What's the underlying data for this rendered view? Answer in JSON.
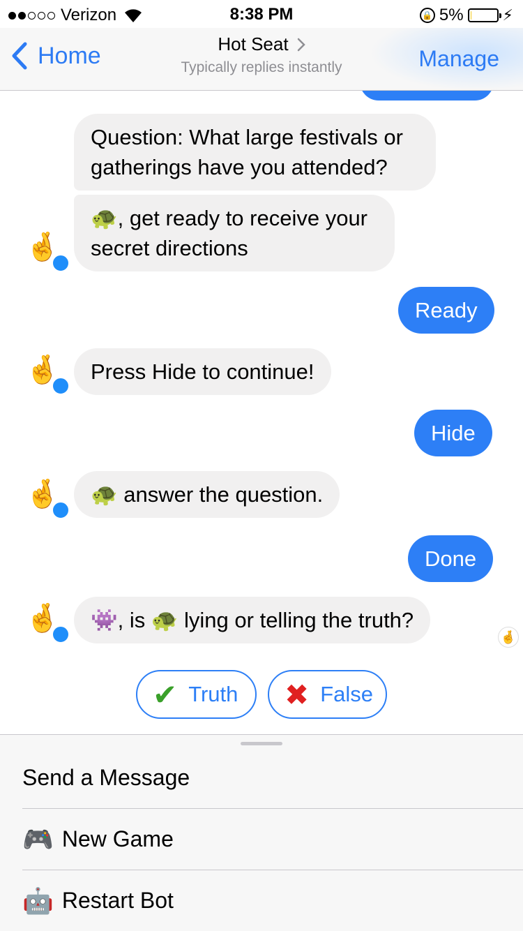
{
  "status_bar": {
    "carrier": "Verizon",
    "time": "8:38 PM",
    "battery": "5%",
    "battery_level": 0.05,
    "signal_bars": 2
  },
  "nav": {
    "back_label": "Home",
    "title": "Hot Seat",
    "subtitle": "Typically replies instantly",
    "right_label": "Manage"
  },
  "messages": [
    {
      "from": "bot",
      "text": "Question: What large festivals or gatherings have you attended?"
    },
    {
      "from": "bot",
      "text": "🐢, get ready to receive your secret directions"
    },
    {
      "from": "user",
      "text": "Ready"
    },
    {
      "from": "bot",
      "text": "Press Hide to continue!"
    },
    {
      "from": "user",
      "text": "Hide"
    },
    {
      "from": "bot",
      "text": "🐢 answer the question."
    },
    {
      "from": "user",
      "text": "Done"
    },
    {
      "from": "bot",
      "text": "👾, is 🐢 lying or telling the truth?"
    }
  ],
  "quick_replies": [
    {
      "icon": "✔",
      "label": "Truth"
    },
    {
      "icon": "✖",
      "label": "False"
    }
  ],
  "menu": [
    {
      "icon": "",
      "label": "Send a Message"
    },
    {
      "icon": "🎮",
      "label": "New Game"
    },
    {
      "icon": "🤖",
      "label": "Restart Bot"
    }
  ],
  "icons": {
    "bot_avatar": "🤞",
    "accent": "#2d7ff6"
  }
}
